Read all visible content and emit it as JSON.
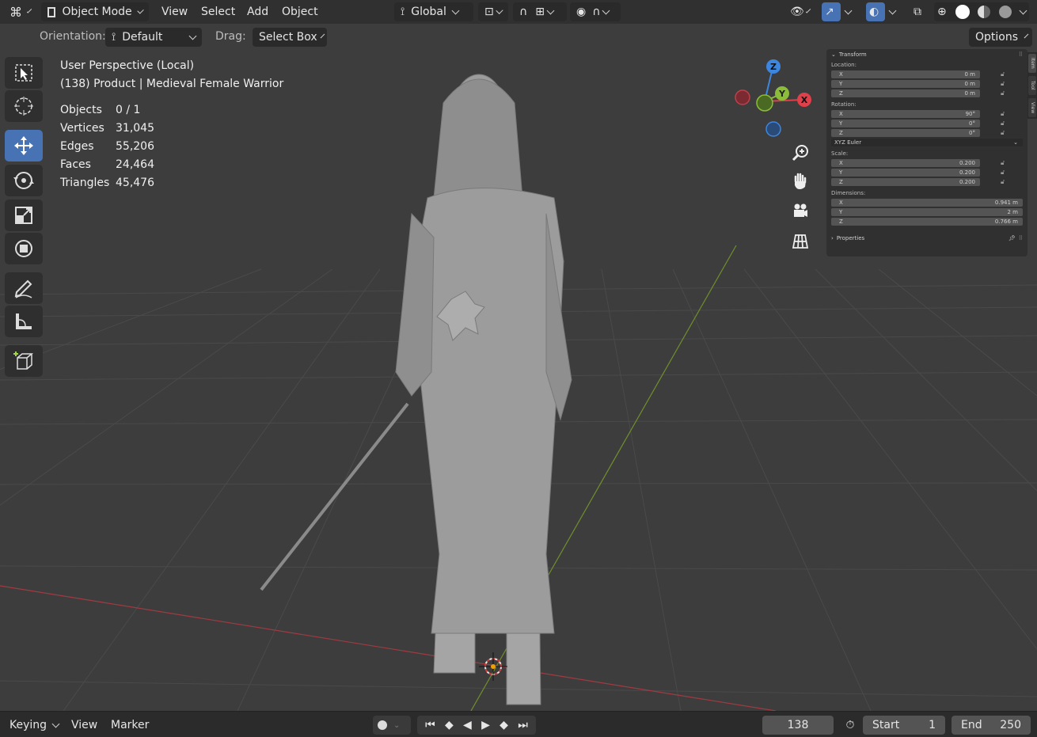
{
  "header": {
    "mode": "Object Mode",
    "menu": [
      "View",
      "Select",
      "Add",
      "Object"
    ],
    "transform_orientation": "Global",
    "options_label": "Options"
  },
  "subheader": {
    "orientation_label": "Orientation:",
    "orientation_value": "Default",
    "drag_label": "Drag:",
    "drag_value": "Select Box"
  },
  "overlay": {
    "view_name": "User Perspective (Local)",
    "object_info": "(138) Product | Medieval Female Warrior",
    "stats": [
      {
        "label": "Objects",
        "value": "0 / 1"
      },
      {
        "label": "Vertices",
        "value": "31,045"
      },
      {
        "label": "Edges",
        "value": "55,206"
      },
      {
        "label": "Faces",
        "value": "24,464"
      },
      {
        "label": "Triangles",
        "value": "45,476"
      }
    ]
  },
  "gizmo": {
    "x": "X",
    "y": "Y",
    "z": "Z"
  },
  "npanel": {
    "tabs": [
      "Item",
      "Tool",
      "View"
    ],
    "transform_title": "Transform",
    "location_label": "Location:",
    "location": [
      {
        "axis": "X",
        "value": "0 m"
      },
      {
        "axis": "Y",
        "value": "0 m"
      },
      {
        "axis": "Z",
        "value": "0 m"
      }
    ],
    "rotation_label": "Rotation:",
    "rotation": [
      {
        "axis": "X",
        "value": "90°"
      },
      {
        "axis": "Y",
        "value": "0°"
      },
      {
        "axis": "Z",
        "value": "0°"
      }
    ],
    "rotation_mode": "XYZ Euler",
    "scale_label": "Scale:",
    "scale": [
      {
        "axis": "X",
        "value": "0.200"
      },
      {
        "axis": "Y",
        "value": "0.200"
      },
      {
        "axis": "Z",
        "value": "0.200"
      }
    ],
    "dimensions_label": "Dimensions:",
    "dimensions": [
      {
        "axis": "X",
        "value": "0.941 m"
      },
      {
        "axis": "Y",
        "value": "2 m"
      },
      {
        "axis": "Z",
        "value": "0.766 m"
      }
    ],
    "properties_title": "Properties"
  },
  "timeline": {
    "keying": "Keying",
    "view": "View",
    "marker": "Marker",
    "current_frame": "138",
    "start_label": "Start",
    "start_value": "1",
    "end_label": "End",
    "end_value": "250"
  },
  "colors": {
    "accent": "#4772b3",
    "x_axis": "#e0404a",
    "y_axis": "#8bbc3a",
    "z_axis": "#3d86e0"
  }
}
